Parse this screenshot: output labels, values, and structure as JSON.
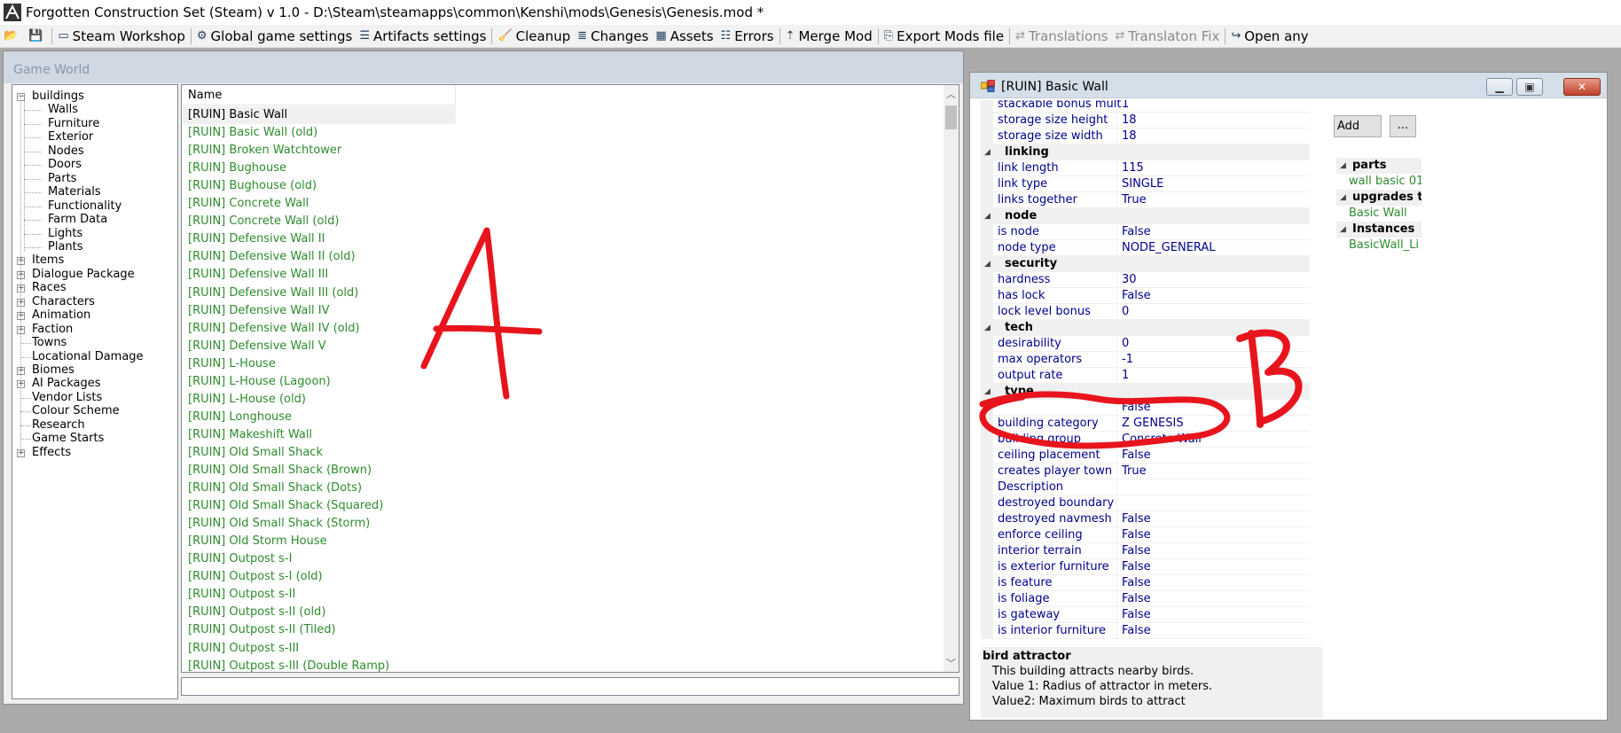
{
  "window": {
    "title": "Forgotten Construction Set (Steam) v 1.0 - D:\\Steam\\steamapps\\common\\Kenshi\\mods\\Genesis\\Genesis.mod *"
  },
  "toolbar": [
    {
      "icon": "open-folder-icon",
      "label": ""
    },
    {
      "icon": "save-disk-icon",
      "label": ""
    },
    {
      "icon": "monitor-icon",
      "label": "Steam Workshop"
    },
    {
      "icon": "gear-icon",
      "label": "Global game settings"
    },
    {
      "icon": "list-icon",
      "label": "Artifacts settings"
    },
    {
      "icon": "broom-icon",
      "label": "Cleanup"
    },
    {
      "icon": "changes-icon",
      "label": "Changes"
    },
    {
      "icon": "assets-icon",
      "label": "Assets"
    },
    {
      "icon": "errors-icon",
      "label": "Errors"
    },
    {
      "icon": "merge-arrow-icon",
      "label": "Merge Mod"
    },
    {
      "icon": "export-icon",
      "label": "Export Mods file"
    },
    {
      "icon": "translate-icon",
      "label": "Translations",
      "disabled": true
    },
    {
      "icon": "translate-fix-icon",
      "label": "Translaton Fix",
      "disabled": true
    },
    {
      "icon": "open-any-icon",
      "label": "Open any"
    }
  ],
  "game_world": {
    "title": "Game World",
    "tree": [
      {
        "label": "buildings",
        "level": 0,
        "expander": "−"
      },
      {
        "label": "Walls",
        "level": 1
      },
      {
        "label": "Furniture",
        "level": 1
      },
      {
        "label": "Exterior",
        "level": 1
      },
      {
        "label": "Nodes",
        "level": 1
      },
      {
        "label": "Doors",
        "level": 1
      },
      {
        "label": "Parts",
        "level": 1
      },
      {
        "label": "Materials",
        "level": 1
      },
      {
        "label": "Functionality",
        "level": 1
      },
      {
        "label": "Farm Data",
        "level": 1
      },
      {
        "label": "Lights",
        "level": 1
      },
      {
        "label": "Plants",
        "level": 1
      },
      {
        "label": "Items",
        "level": 0,
        "expander": "+"
      },
      {
        "label": "Dialogue Package",
        "level": 0,
        "expander": "+"
      },
      {
        "label": "Races",
        "level": 0,
        "expander": "+"
      },
      {
        "label": "Characters",
        "level": 0,
        "expander": "+"
      },
      {
        "label": "Animation",
        "level": 0,
        "expander": "+"
      },
      {
        "label": "Faction",
        "level": 0,
        "expander": "+"
      },
      {
        "label": "Towns",
        "level": 0
      },
      {
        "label": "Locational Damage",
        "level": 0
      },
      {
        "label": "Biomes",
        "level": 0,
        "expander": "+"
      },
      {
        "label": "AI Packages",
        "level": 0,
        "expander": "+"
      },
      {
        "label": "Vendor Lists",
        "level": 0
      },
      {
        "label": "Colour Scheme",
        "level": 0
      },
      {
        "label": "Research",
        "level": 0
      },
      {
        "label": "Game Starts",
        "level": 0
      },
      {
        "label": "Effects",
        "level": 0,
        "expander": "+"
      }
    ],
    "list_header": "Name",
    "items": [
      "[RUIN] Basic Wall",
      "[RUIN] Basic Wall (old)",
      "[RUIN] Broken Watchtower",
      "[RUIN] Bughouse",
      "[RUIN] Bughouse (old)",
      "[RUIN] Concrete Wall",
      "[RUIN] Concrete Wall (old)",
      "[RUIN] Defensive Wall II",
      "[RUIN] Defensive Wall II (old)",
      "[RUIN] Defensive Wall III",
      "[RUIN] Defensive Wall III (old)",
      "[RUIN] Defensive Wall IV",
      "[RUIN] Defensive Wall IV (old)",
      "[RUIN] Defensive Wall V",
      "[RUIN] L-House",
      "[RUIN] L-House (Lagoon)",
      "[RUIN] L-House (old)",
      "[RUIN] Longhouse",
      "[RUIN] Makeshift Wall",
      "[RUIN] Old Small Shack",
      "[RUIN] Old Small Shack (Brown)",
      "[RUIN] Old Small Shack (Dots)",
      "[RUIN] Old Small Shack (Squared)",
      "[RUIN] Old Small Shack (Storm)",
      "[RUIN] Old Storm House",
      "[RUIN] Outpost s-I",
      "[RUIN] Outpost s-I (old)",
      "[RUIN] Outpost s-II",
      "[RUIN] Outpost s-II (old)",
      "[RUIN] Outpost s-II (Tiled)",
      "[RUIN] Outpost s-III",
      "[RUIN] Outpost s-III (Double Ramp)"
    ],
    "search_value": ""
  },
  "annotations": {
    "a": "A",
    "b": "B",
    "color": "#e8141c"
  },
  "properties_window": {
    "title": "[RUIN] Basic Wall",
    "rows": [
      {
        "type": "prop",
        "name": "stackable bonus mult",
        "value": "1"
      },
      {
        "type": "prop",
        "name": "storage size height",
        "value": "18"
      },
      {
        "type": "prop",
        "name": "storage size width",
        "value": "18"
      },
      {
        "type": "cat",
        "name": "linking"
      },
      {
        "type": "prop",
        "name": "link length",
        "value": "115"
      },
      {
        "type": "prop",
        "name": "link type",
        "value": "SINGLE"
      },
      {
        "type": "prop",
        "name": "links together",
        "value": "True"
      },
      {
        "type": "cat",
        "name": "node"
      },
      {
        "type": "prop",
        "name": "is node",
        "value": "False"
      },
      {
        "type": "prop",
        "name": "node type",
        "value": "NODE_GENERAL"
      },
      {
        "type": "cat",
        "name": "security"
      },
      {
        "type": "prop",
        "name": "hardness",
        "value": "30"
      },
      {
        "type": "prop",
        "name": "has lock",
        "value": "False"
      },
      {
        "type": "prop",
        "name": "lock level bonus",
        "value": "0"
      },
      {
        "type": "cat",
        "name": "tech"
      },
      {
        "type": "prop",
        "name": "desirability",
        "value": "0"
      },
      {
        "type": "prop",
        "name": "max operators",
        "value": "-1"
      },
      {
        "type": "prop",
        "name": "output rate",
        "value": "1"
      },
      {
        "type": "cat",
        "name": "type"
      },
      {
        "type": "prop",
        "name": "",
        "value": "False"
      },
      {
        "type": "prop",
        "name": "building category",
        "value": "Z GENESIS"
      },
      {
        "type": "prop",
        "name": "building group",
        "value": "Concrete Wall"
      },
      {
        "type": "prop",
        "name": "ceiling placement",
        "value": "False"
      },
      {
        "type": "prop",
        "name": "creates player town",
        "value": "True"
      },
      {
        "type": "prop",
        "name": "Description",
        "value": ""
      },
      {
        "type": "prop",
        "name": "destroyed boundary",
        "value": ""
      },
      {
        "type": "prop",
        "name": "destroyed navmesh",
        "value": "False"
      },
      {
        "type": "prop",
        "name": "enforce ceiling",
        "value": "False"
      },
      {
        "type": "prop",
        "name": "interior terrain",
        "value": "False"
      },
      {
        "type": "prop",
        "name": "is exterior furniture",
        "value": "False"
      },
      {
        "type": "prop",
        "name": "is feature",
        "value": "False"
      },
      {
        "type": "prop",
        "name": "is foliage",
        "value": "False"
      },
      {
        "type": "prop",
        "name": "is gateway",
        "value": "False"
      },
      {
        "type": "prop",
        "name": "is interior furniture",
        "value": "False"
      }
    ],
    "help": {
      "title": "bird attractor",
      "lines": [
        "This building attracts nearby birds.",
        "Value 1: Radius of attractor in meters.",
        "Value2: Maximum birds to attract"
      ]
    },
    "add_button": "Add",
    "more_button": "...",
    "references": [
      {
        "category": "parts",
        "items": [
          "wall basic 01"
        ]
      },
      {
        "category": "upgrades t",
        "items": [
          "Basic Wall"
        ]
      },
      {
        "category": "Instances",
        "items": [
          "BasicWall_Li"
        ]
      }
    ]
  }
}
